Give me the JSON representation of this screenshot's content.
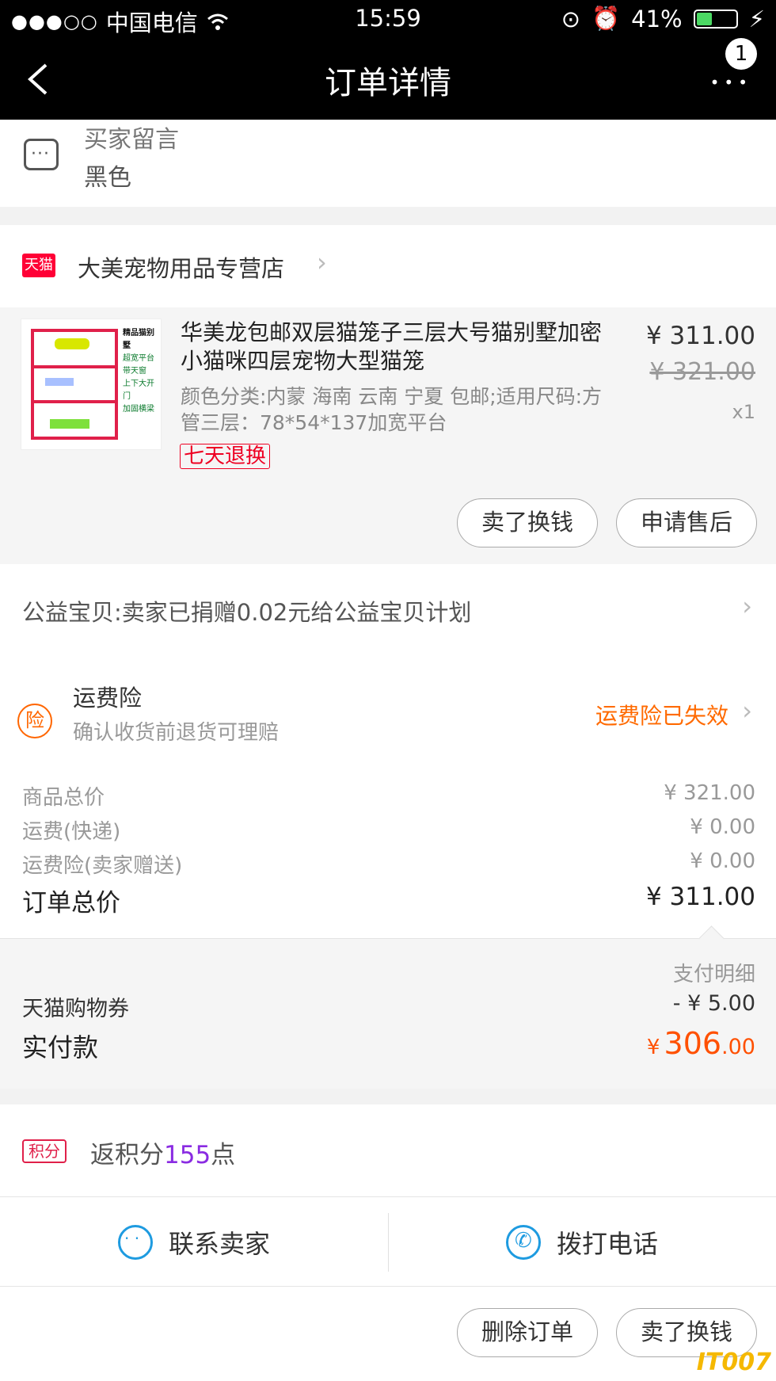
{
  "status_bar": {
    "signal": "●●●○○",
    "carrier": "中国电信",
    "wifi_icon": "wifi-icon",
    "time": "15:59",
    "battery": "41%",
    "battery_level": 0.41
  },
  "nav": {
    "title": "订单详情",
    "badge": "1",
    "more": "•••"
  },
  "buyer_message": {
    "label": "买家留言",
    "value": "黑色"
  },
  "store": {
    "logo_text": "天猫",
    "name": "大美宠物用品专营店",
    "chevron": "›"
  },
  "item": {
    "thumb_text": [
      "精品猫别墅",
      "超宽平台",
      "带天窗",
      "上下大开门",
      "加固横梁"
    ],
    "title": "华美龙包邮双层猫笼子三层大号猫别墅加密小猫咪四层宠物大型猫笼",
    "props": "颜色分类:内蒙 海南 云南 宁夏 包邮;适用尺码:方管三层：78*54*137加宽平台",
    "tag": "七天退换",
    "price": "¥ 311.00",
    "old_price": "¥ 321.00",
    "qty": "x1",
    "btn_sell": "卖了换钱",
    "btn_after_sale": "申请售后"
  },
  "charity": {
    "text": "公益宝贝:卖家已捐赠0.02元给公益宝贝计划",
    "chevron": "›"
  },
  "insurance": {
    "icon": "险",
    "title": "运费险",
    "subtitle": "确认收货前退货可理赔",
    "status": "运费险已失效",
    "chevron": "›",
    "status_color": "#ff6a00"
  },
  "summary": {
    "goods_label": "商品总价",
    "goods_value": "¥ 321.00",
    "shipping_label": "运费(快递)",
    "shipping_value": "¥ 0.00",
    "ins_label": "运费险(卖家赠送)",
    "ins_value": "¥ 0.00",
    "total_label": "订单总价",
    "total_value": "¥ 311.00"
  },
  "payment": {
    "detail_link": "支付明细",
    "coupon_label": "天猫购物券",
    "coupon_value": "- ¥ 5.00",
    "paid_label": "实付款",
    "paid_symbol": "¥",
    "paid_int": "306",
    "paid_dec": ".00",
    "paid_color": "#ff5000"
  },
  "points": {
    "icon": "积分",
    "prefix": "返积分",
    "value": "155",
    "suffix": "点",
    "value_color": "#8a2be2"
  },
  "contact": {
    "seller": "联系卖家",
    "phone": "拨打电话"
  },
  "footer": {
    "btn_delete": "删除订单",
    "btn_sell": "卖了换钱"
  },
  "watermark": "IT007"
}
